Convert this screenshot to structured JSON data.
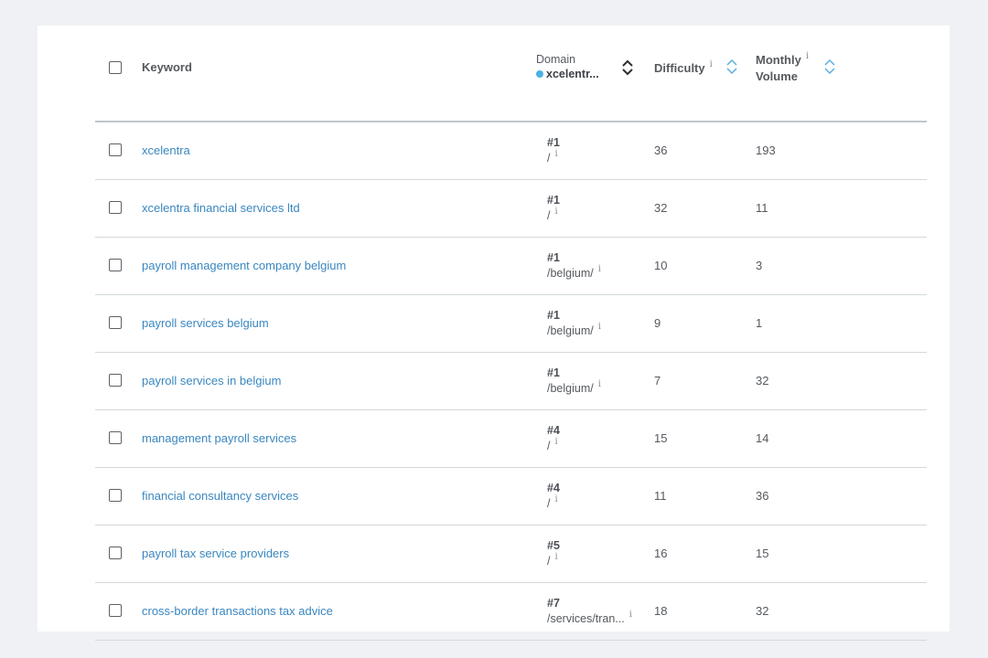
{
  "header": {
    "keyword": "Keyword",
    "domain_label": "Domain",
    "domain_value": "xcelentr...",
    "difficulty": "Difficulty",
    "volume_line1": "Monthly",
    "volume_line2": "Volume",
    "info_glyph": "i"
  },
  "colors": {
    "accent": "#3a87c0",
    "domain_dot": "#4bb2e5",
    "sort_arrow_active": "#2b2f33",
    "sort_arrow": "#5aaee0"
  },
  "rows": [
    {
      "keyword": "xcelentra",
      "rank": "#1",
      "url": "/",
      "difficulty": "36",
      "volume": "193"
    },
    {
      "keyword": "xcelentra financial services ltd",
      "rank": "#1",
      "url": "/",
      "difficulty": "32",
      "volume": "11"
    },
    {
      "keyword": "payroll management company belgium",
      "rank": "#1",
      "url": "/belgium/",
      "difficulty": "10",
      "volume": "3"
    },
    {
      "keyword": "payroll services belgium",
      "rank": "#1",
      "url": "/belgium/",
      "difficulty": "9",
      "volume": "1"
    },
    {
      "keyword": "payroll services in belgium",
      "rank": "#1",
      "url": "/belgium/",
      "difficulty": "7",
      "volume": "32"
    },
    {
      "keyword": "management payroll services",
      "rank": "#4",
      "url": "/",
      "difficulty": "15",
      "volume": "14"
    },
    {
      "keyword": "financial consultancy services",
      "rank": "#4",
      "url": "/",
      "difficulty": "11",
      "volume": "36"
    },
    {
      "keyword": "payroll tax service providers",
      "rank": "#5",
      "url": "/",
      "difficulty": "16",
      "volume": "15"
    },
    {
      "keyword": "cross-border transactions tax advice",
      "rank": "#7",
      "url": "/services/tran...",
      "difficulty": "18",
      "volume": "32"
    }
  ]
}
